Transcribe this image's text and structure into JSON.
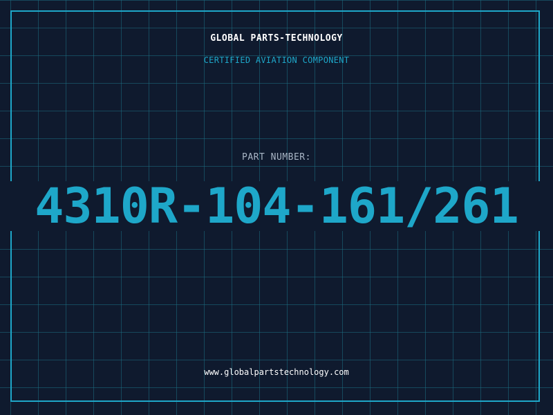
{
  "header": {
    "company": "GLOBAL PARTS-TECHNOLOGY",
    "subtitle": "CERTIFIED AVIATION COMPONENT"
  },
  "part": {
    "label": "PART NUMBER:",
    "number": "4310R-104-161/261"
  },
  "footer": {
    "website": "www.globalpartstechnology.com"
  },
  "colors": {
    "background": "#0f1a2e",
    "accent": "#1ea7c9",
    "grid": "#1c6e82",
    "text_primary": "#ffffff",
    "text_muted": "#a9b6c6"
  }
}
